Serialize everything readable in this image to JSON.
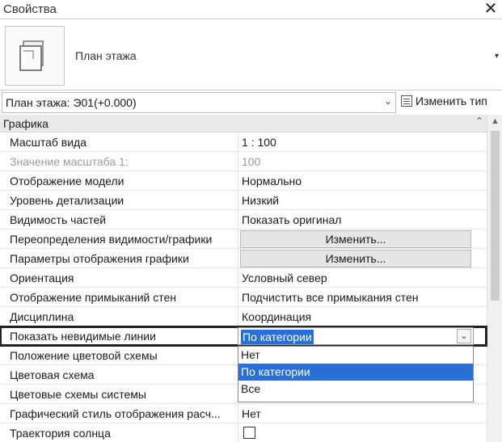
{
  "window": {
    "title": "Свойства",
    "close": "✕"
  },
  "type_selector": {
    "type_name": "План этажа",
    "arrow": "▾"
  },
  "instance_selector": {
    "value": "План этажа: Э01(+0.000)",
    "chevron": "⌄",
    "edit_type": "Изменить тип"
  },
  "group": {
    "label": "Графика",
    "collapse": "⌃"
  },
  "scroll": {
    "up": "▲"
  },
  "rows": [
    {
      "name": "Масштаб вида",
      "value": "1 : 100"
    },
    {
      "name": "Значение масштаба    1:",
      "value": "100"
    },
    {
      "name": "Отображение модели",
      "value": "Нормально"
    },
    {
      "name": "Уровень детализации",
      "value": "Низкий"
    },
    {
      "name": "Видимость частей",
      "value": "Показать оригинал"
    },
    {
      "name": "Переопределения видимости/графики",
      "value": "Изменить..."
    },
    {
      "name": "Параметры отображения графики",
      "value": "Изменить..."
    },
    {
      "name": "Ориентация",
      "value": "Условный север"
    },
    {
      "name": "Отображение примыканий стен",
      "value": "Подчистить все примыкания стен"
    },
    {
      "name": "Дисциплина",
      "value": "Координация"
    },
    {
      "name": "Показать невидимые линии",
      "value": "По категории"
    },
    {
      "name": "Положение цветовой схемы",
      "value": ""
    },
    {
      "name": "Цветовая схема",
      "value": ""
    },
    {
      "name": "Цветовые схемы системы",
      "value": ""
    },
    {
      "name": "Графический стиль отображения расч...",
      "value": "Нет"
    },
    {
      "name": "Траектория солнца",
      "value": "",
      "checked": false
    }
  ],
  "dropdown": {
    "options": [
      "Нет",
      "По категории",
      "Все"
    ],
    "selected": "По категории"
  },
  "colors": {
    "selection": "#2a6fd6",
    "group_bg": "#e9e9e9"
  }
}
